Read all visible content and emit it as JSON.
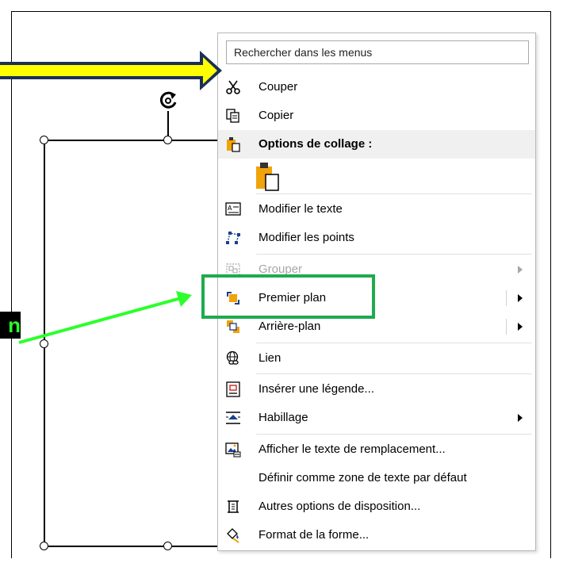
{
  "search": {
    "placeholder": "Rechercher dans les menus"
  },
  "menu": {
    "cut": "Couper",
    "copy": "Copier",
    "paste_options_header": "Options de collage :",
    "edit_text": "Modifier le texte",
    "edit_points": "Modifier les points",
    "group": "Grouper",
    "bring_to_front": "Premier plan",
    "send_to_back": "Arrière-plan",
    "link": "Lien",
    "insert_caption": "Insérer une légende...",
    "wrap_text": "Habillage",
    "view_alt_text": "Afficher le texte de remplacement...",
    "set_default_textbox": "Définir comme zone de texte par défaut",
    "more_layout_options": "Autres options de disposition...",
    "format_shape": "Format de la forme..."
  },
  "callout": {
    "text": "n"
  },
  "colors": {
    "highlight_green": "#1faa4e",
    "arrow_yellow": "#ffff00",
    "arrow_green": "#2bff2b",
    "paste_icon_orange": "#f0a30a"
  }
}
